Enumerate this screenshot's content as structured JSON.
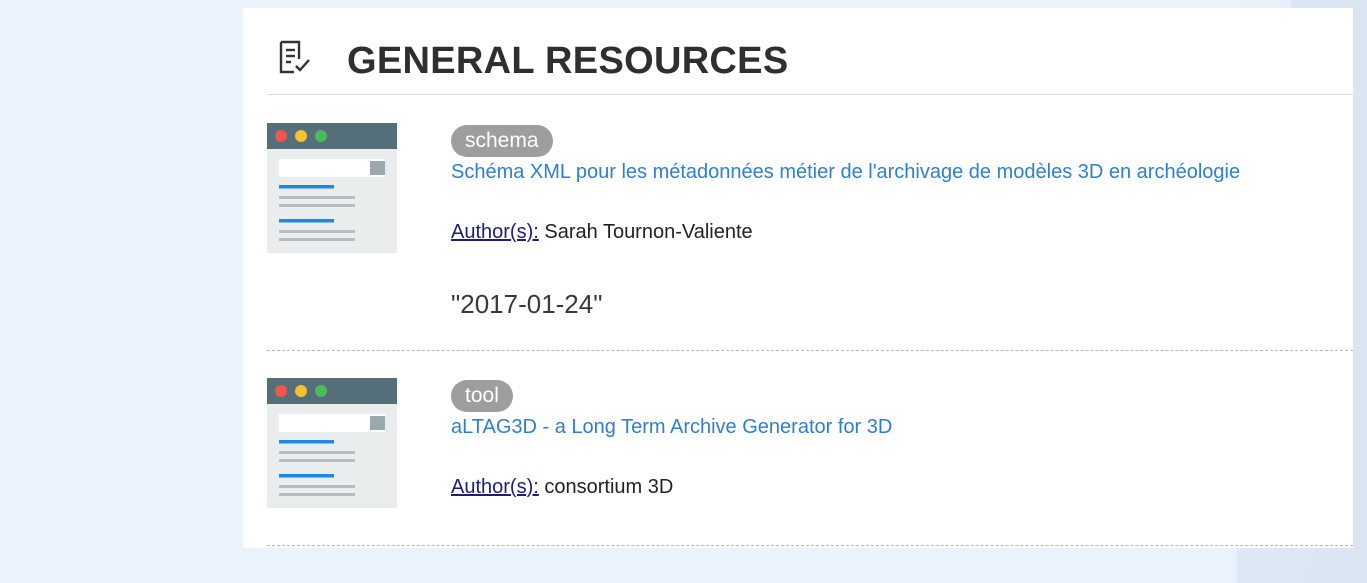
{
  "section": {
    "title": "GENERAL RESOURCES",
    "icon": "checklist-document-icon"
  },
  "resources": [
    {
      "type": "schema",
      "title": "Schéma XML pour les métadonnées métier de l'archivage de modèles 3D en archéologie",
      "authors_label": "Author(s):",
      "authors": "Sarah Tournon-Valiente",
      "date": "\"2017-01-24\"",
      "thumbnail_icon": "browser-window-icon"
    },
    {
      "type": "tool",
      "title": "aLTAG3D - a Long Term Archive Generator for 3D",
      "authors_label": "Author(s):",
      "authors": "consortium 3D",
      "thumbnail_icon": "browser-window-icon"
    }
  ],
  "colors": {
    "link": "#2f7fd0",
    "badge": "#9e9e9e",
    "page_background": "#eaf2fb"
  }
}
